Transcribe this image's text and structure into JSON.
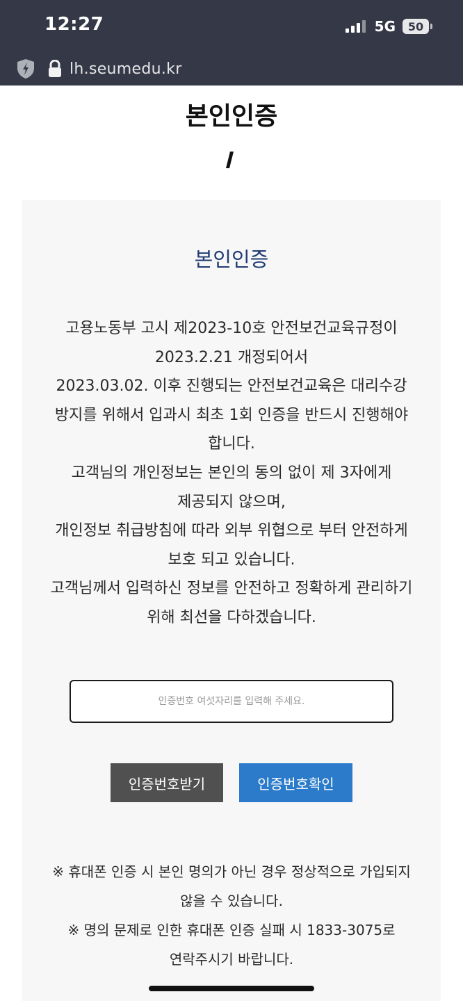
{
  "status_bar": {
    "time": "12:27",
    "network": "5G",
    "battery": "50"
  },
  "browser": {
    "url": "lh.seumedu.kr"
  },
  "page": {
    "heading": "본인인증"
  },
  "card": {
    "title": "본인인증",
    "notice_lines": [
      "고용노동부 고시 제2023-10호 안전보건교육규정이",
      "2023.2.21 개정되어서",
      "2023.03.02. 이후 진행되는 안전보건교육은 대리수강",
      "방지를 위해서 입과시 최초 1회 인증을 반드시 진행해야",
      "합니다.",
      "고객님의 개인정보는 본인의 동의 없이 제 3자에게",
      "제공되지 않으며,",
      "개인정보 취급방침에 따라 외부 위협으로 부터 안전하게",
      "보호 되고 있습니다.",
      "고객님께서 입력하신 정보를 안전하고 정확하게 관리하기",
      "위해 최선을 다하겠습니다."
    ],
    "code_input": {
      "value": "",
      "placeholder": "인증번호 여섯자리를 입력해 주세요."
    },
    "buttons": {
      "receive_label": "인증번호받기",
      "confirm_label": "인증번호확인"
    },
    "footnote_lines": [
      "※ 휴대폰 인증 시 본인 명의가 아닌 경우 정상적으로 가입되지",
      "않을 수 있습니다.",
      "※ 명의 문제로 인한 휴대폰 인증 실패 시 1833-3075로",
      "연락주시기 바랍니다."
    ]
  },
  "colors": {
    "status_bar_bg": "#353846",
    "card_bg": "#f7f7f7",
    "card_title": "#1f3b73",
    "receive_button": "#505050",
    "confirm_button": "#2b7bca"
  },
  "icons": {
    "browser_shield": "shield-icon",
    "url_lock": "lock-icon",
    "signal": "cellular-signal-icon",
    "battery": "battery-icon"
  }
}
